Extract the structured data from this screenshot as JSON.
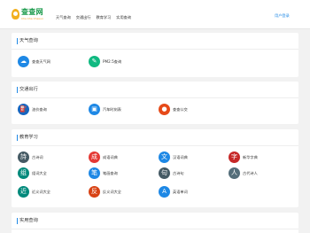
{
  "header": {
    "logo_title": "查查网",
    "logo_subtitle": "Cha Cha Chaxun",
    "nav": [
      "天气查询",
      "交通出行",
      "教育学习",
      "实用查询"
    ],
    "login": "用户登录"
  },
  "sections": [
    {
      "title": "天气查询",
      "items": [
        {
          "label": "查查天气网",
          "icon": "cloud-icon",
          "color": "#1e88e5",
          "glyph": "☁"
        },
        {
          "label": "PM2.5查询",
          "icon": "leaf-icon",
          "color": "#10b981",
          "glyph": "✎"
        }
      ]
    },
    {
      "title": "交通出行",
      "items": [
        {
          "label": "油价查询",
          "icon": "fuel-icon",
          "color": "#1565c0",
          "glyph": "⛽"
        },
        {
          "label": "汽车时刻表",
          "icon": "bus-icon",
          "color": "#1e88e5",
          "glyph": "▣"
        },
        {
          "label": "查查公交",
          "icon": "map-pin-icon",
          "color": "#e64a19",
          "glyph": "●"
        }
      ]
    },
    {
      "title": "教育学习",
      "items": [
        {
          "label": "古诗词",
          "icon": "poetry-icon",
          "color": "#455a64",
          "glyph": "詩"
        },
        {
          "label": "成语词典",
          "icon": "idiom-icon",
          "color": "#e53935",
          "glyph": "成"
        },
        {
          "label": "汉语词典",
          "icon": "dictionary-icon",
          "color": "#1e88e5",
          "glyph": "文"
        },
        {
          "label": "新华字典",
          "icon": "character-icon",
          "color": "#c62828",
          "glyph": "字"
        },
        {
          "label": "组词大全",
          "icon": "word-group-icon",
          "color": "#00897b",
          "glyph": "组"
        },
        {
          "label": "笔画查询",
          "icon": "stroke-icon",
          "color": "#1e88e5",
          "glyph": "笔"
        },
        {
          "label": "古诗句",
          "icon": "verse-icon",
          "color": "#455a64",
          "glyph": "句"
        },
        {
          "label": "古代诗人",
          "icon": "poet-icon",
          "color": "#546e7a",
          "glyph": "人"
        },
        {
          "label": "近义词大全",
          "icon": "synonym-icon",
          "color": "#00897b",
          "glyph": "近"
        },
        {
          "label": "反义词大全",
          "icon": "antonym-icon",
          "color": "#d84315",
          "glyph": "反"
        },
        {
          "label": "英语单词",
          "icon": "english-icon",
          "color": "#1e88e5",
          "glyph": "A"
        }
      ]
    },
    {
      "title": "实用查询",
      "items": []
    }
  ]
}
